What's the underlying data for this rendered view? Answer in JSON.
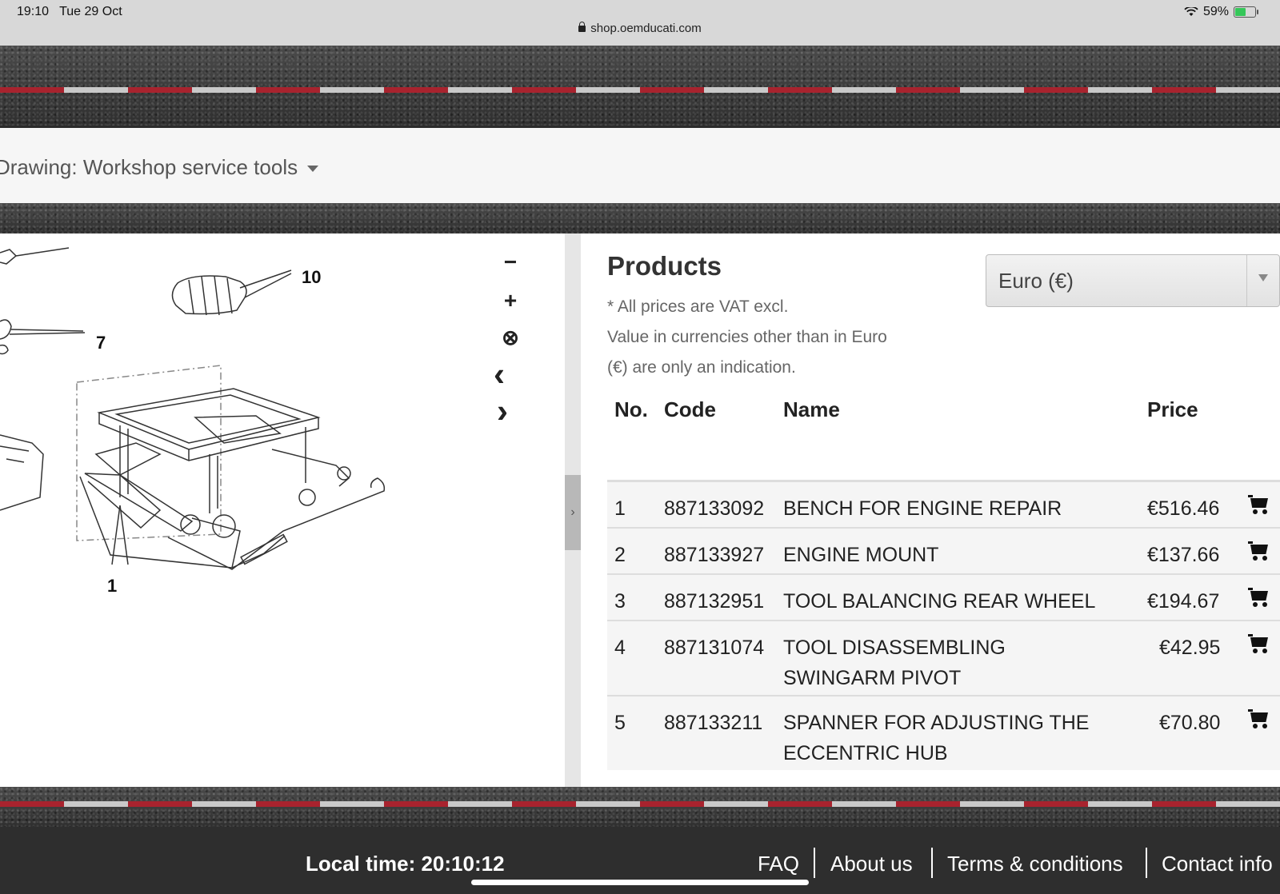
{
  "status_bar": {
    "time": "19:10",
    "date": "Tue 29 Oct",
    "url": "shop.oemducati.com",
    "battery": "59%",
    "battery_level": 0.59
  },
  "drawing": {
    "title": "Drawing: Workshop service tools"
  },
  "viewer": {
    "controls": {
      "zoom_out": "−",
      "zoom_in": "+",
      "reset": "⊗",
      "prev": "‹",
      "next": "›"
    },
    "callouts": [
      "10",
      "7",
      "1"
    ]
  },
  "products": {
    "title": "Products",
    "currency": "Euro (€)",
    "notes": [
      "* All prices are VAT excl.",
      "Value in currencies other than in Euro",
      "(€) are only an indication."
    ],
    "columns": {
      "no": "No.",
      "code": "Code",
      "name": "Name",
      "price": "Price"
    },
    "rows": [
      {
        "no": "1",
        "code": "887133092",
        "name": "BENCH FOR ENGINE REPAIR",
        "price": "€516.46"
      },
      {
        "no": "2",
        "code": "887133927",
        "name": "ENGINE MOUNT",
        "price": "€137.66"
      },
      {
        "no": "3",
        "code": "887132951",
        "name": "TOOL BALANCING REAR WHEEL",
        "price": "€194.67"
      },
      {
        "no": "4",
        "code": "887131074",
        "name": "TOOL DISASSEMBLING SWINGARM PIVOT",
        "price": "€42.95"
      },
      {
        "no": "5",
        "code": "887133211",
        "name": "SPANNER FOR ADJUSTING THE ECCENTRIC HUB",
        "price": "€70.80"
      }
    ]
  },
  "footer": {
    "local_time": "Local time: 20:10:12",
    "links": [
      "FAQ",
      "About us",
      "Terms & conditions",
      "Contact info"
    ]
  },
  "colors": {
    "stripe_red": "#a8232e",
    "footer_bg": "#2e2e2e"
  }
}
